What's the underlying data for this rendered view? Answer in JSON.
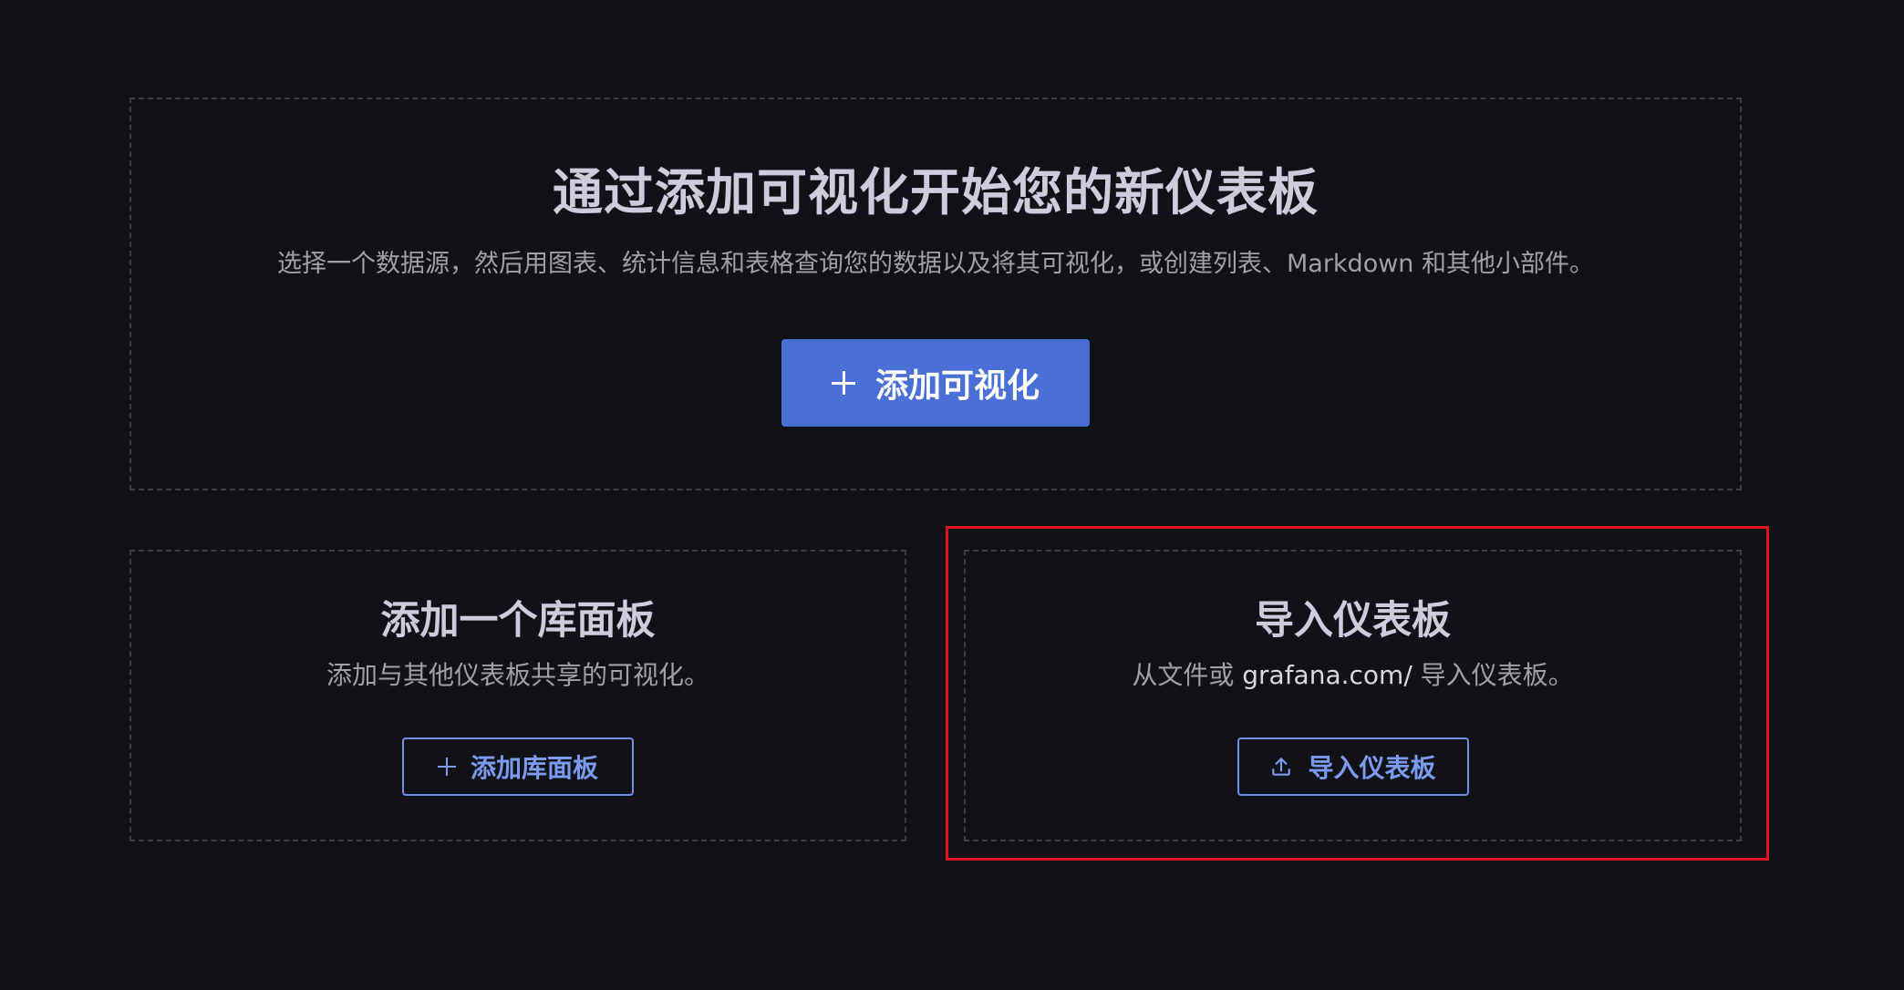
{
  "main_card": {
    "title": "通过添加可视化开始您的新仪表板",
    "subtitle": "选择一个数据源，然后用图表、统计信息和表格查询您的数据以及将其可视化，或创建列表、Markdown 和其他小部件。",
    "button_label": "添加可视化",
    "button_icon": "plus-icon"
  },
  "library_card": {
    "title": "添加一个库面板",
    "description": "添加与其他仪表板共享的可视化。",
    "button_label": "添加库面板",
    "button_icon": "plus-icon"
  },
  "import_card": {
    "title": "导入仪表板",
    "description_prefix": "从文件或 ",
    "description_link": "grafana.com/",
    "description_suffix": " 导入仪表板。",
    "button_label": "导入仪表板",
    "button_icon": "upload-icon"
  },
  "colors": {
    "background": "#111217",
    "primary_button": "#4a6fd6",
    "outline_button": "#6e8fe8",
    "highlight": "#e0141e"
  }
}
